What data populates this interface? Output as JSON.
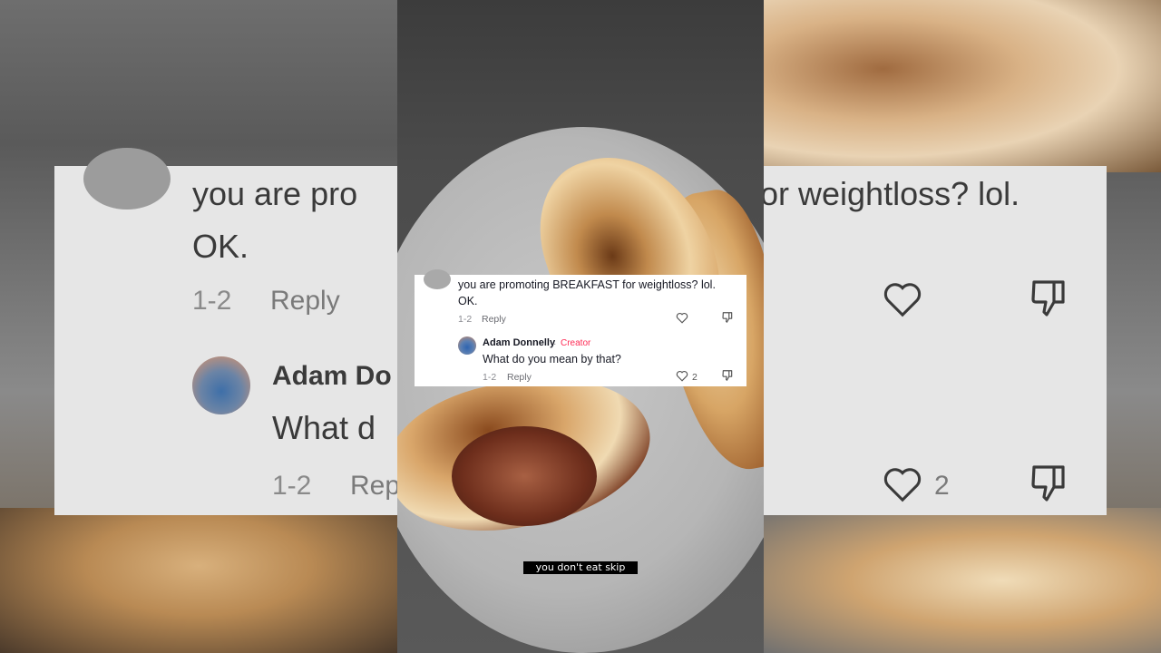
{
  "comment": {
    "text_line1": "you are promoting BREAKFAST for weightloss? lol.",
    "text_line2": "OK.",
    "date": "1-2",
    "reply_label": "Reply"
  },
  "reply": {
    "author": "Adam Donnelly",
    "separator": "·",
    "badge": "Creator",
    "text": "What do you mean by that?",
    "date": "1-2",
    "reply_label": "Reply",
    "like_count": "2"
  },
  "background_comment": {
    "line1_left": "you are pro",
    "line1_right": "or weightloss? lol.",
    "line2": "OK.",
    "date": "1-2",
    "reply_label": "Reply",
    "reply_author_partial": "Adam Do",
    "reply_text_partial": "What d",
    "reply_date": "1-2",
    "reply_label_partial": "Rep",
    "like_count": "2"
  },
  "caption": "you don't eat skip",
  "icons": {
    "heart": "heart-icon",
    "dislike": "thumbs-down-icon"
  },
  "colors": {
    "creator_badge": "#fe2c55",
    "text": "#161823",
    "meta": "#8a8b91"
  }
}
